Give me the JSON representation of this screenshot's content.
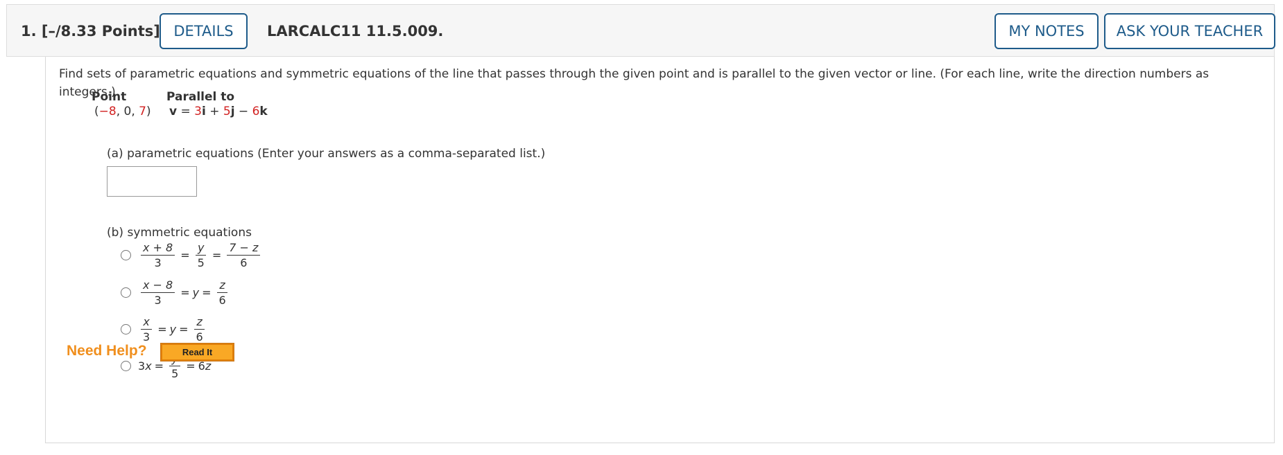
{
  "header": {
    "question_label": "1.  [–/8.33 Points]",
    "details_button": "DETAILS",
    "problem_code": "LARCALC11 11.5.009.",
    "my_notes_button": "MY NOTES",
    "ask_teacher_button": "ASK YOUR TEACHER"
  },
  "question": {
    "prompt": "Find sets of parametric equations and symmetric equations of the line that passes through the given point and is parallel to the given vector or line. (For each line, write the direction numbers as integers.)",
    "point_header": "Point",
    "parallel_header": "Parallel to",
    "point": {
      "open": "(",
      "x": "−8",
      "sep1": ", ",
      "y": "0",
      "sep2": ", ",
      "z": "7",
      "close": ")"
    },
    "vector": {
      "v": "v",
      "eq": " = ",
      "a": "3",
      "i": "i",
      "plus": " + ",
      "b": "5",
      "j": "j",
      "minus": " − ",
      "c": "6",
      "k": "k"
    },
    "part_a_label": "(a) parametric equations (Enter your answers as a comma-separated list.)",
    "part_a_value": "",
    "part_b_label": "(b) symmetric equations",
    "options": [
      {
        "n1": "x + 8",
        "d1": "3",
        "n2": "y",
        "d2": "5",
        "n3": "7 − z",
        "d3": "6",
        "eq": "="
      },
      {
        "n1": "x − 8",
        "d1": "3",
        "mid": "y",
        "n3": "z",
        "d3": "6",
        "eq": "="
      },
      {
        "n1": "x",
        "d1": "3",
        "mid": "y",
        "n3": "z",
        "d3": "6",
        "eq": "="
      },
      {
        "lhs_coef": "3",
        "lhs_var": "x",
        "n2": "y",
        "d2": "5",
        "rhs_coef": "6",
        "rhs_var": "z",
        "eq": "="
      }
    ]
  },
  "help": {
    "need_help": "Need Help?",
    "read_it": "Read It"
  },
  "colors": {
    "accent_blue": "#1e5b8a",
    "given_red": "#d22222",
    "help_orange": "#f08f1e",
    "read_it_bg": "#f9a825"
  }
}
